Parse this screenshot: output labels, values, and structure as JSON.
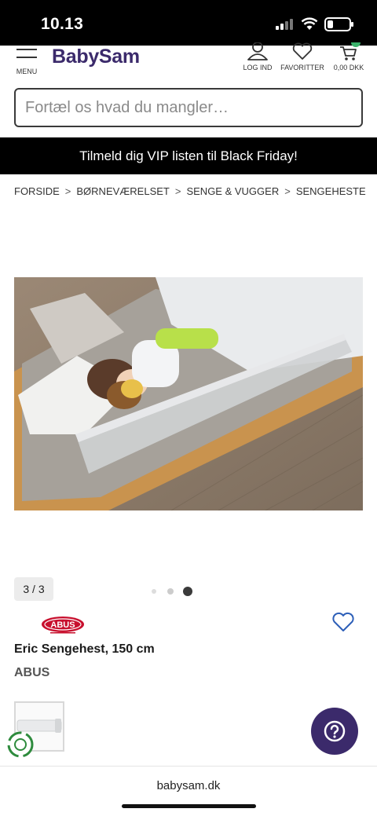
{
  "status": {
    "time": "10.13"
  },
  "header": {
    "menu_label": "MENU",
    "logo": "BabySam",
    "login_label": "LOG IND",
    "favorites_label": "FAVORITTER",
    "cart_total": "0,00 DKK"
  },
  "search": {
    "placeholder": "Fortæl os hvad du mangler…"
  },
  "banner": {
    "text": "Tilmeld dig VIP listen til Black Friday!"
  },
  "breadcrumb": [
    "FORSIDE",
    "BØRNEVÆRELSET",
    "SENGE & VUGGER",
    "SENGEHESTE"
  ],
  "gallery": {
    "counter": "3 / 3",
    "active_index": 3,
    "total": 3
  },
  "product": {
    "brand_logo_text": "ABUS",
    "title": "Eric Sengehest, 150 cm",
    "brand": "ABUS"
  },
  "browser": {
    "url": "babysam.dk"
  },
  "colors": {
    "brand_purple": "#3b2a6b",
    "abus_red": "#c8102e"
  }
}
